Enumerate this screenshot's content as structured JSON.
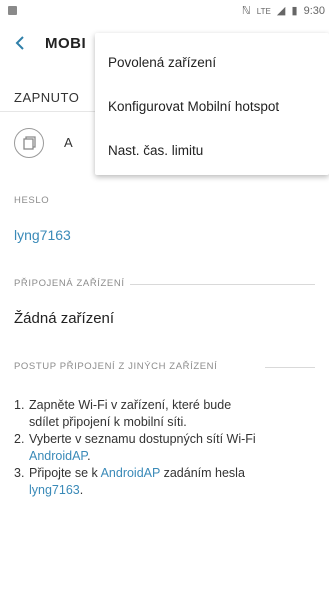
{
  "status_bar": {
    "network": "LTE",
    "time": "9:30"
  },
  "toolbar": {
    "title": "MOBI"
  },
  "switch_row": {
    "label": "ZAPNUTO"
  },
  "share_row": {
    "truncated_text": "A"
  },
  "password_section": {
    "label": "HESLO",
    "value": "lyng7163"
  },
  "connected_section": {
    "label": "PŘIPOJENÁ ZAŘÍZENÍ",
    "value": "Žádná zařízení"
  },
  "instructions_section": {
    "label": "POSTUP PŘIPOJENÍ Z JINÝCH ZAŘÍZENÍ",
    "items": [
      {
        "num": "1.",
        "line1": "Zapněte Wi-Fi v zařízení, které bude",
        "line2": "sdílet připojení k mobilní síti."
      },
      {
        "num": "2.",
        "line1": "Vyberte v seznamu dostupných sítí Wi-Fi",
        "link": "AndroidAP",
        "after": "."
      },
      {
        "num": "3.",
        "before": "Připojte se k ",
        "link": "AndroidAP",
        "after": " zadáním hesla",
        "password": "lyng7163",
        "end": "."
      }
    ]
  },
  "popup_menu": {
    "items": [
      "Povolená zařízení",
      "Konfigurovat Mobilní hotspot",
      "Nast. čas. limitu"
    ]
  },
  "colors": {
    "accent": "#3a8ab8",
    "back_arrow": "#2f7fa9"
  }
}
